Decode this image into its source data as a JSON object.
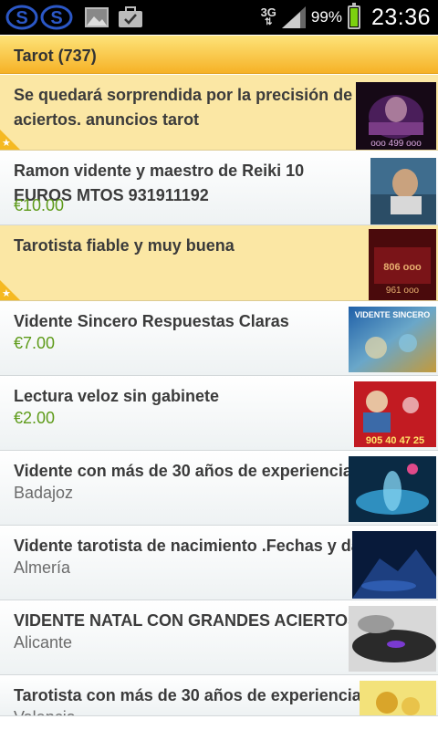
{
  "status_bar": {
    "network": "3G",
    "battery": "99%",
    "battery_level": 0.99,
    "time": "23:36",
    "icons": [
      "app-s-icon",
      "app-s-icon",
      "gallery-icon",
      "briefcase-check-icon",
      "signal-icon",
      "battery-icon"
    ]
  },
  "category": {
    "title": "Tarot (737)"
  },
  "listings": [
    {
      "title": "Se quedará sorprendida por la precisión de aciertos. anuncios tarot",
      "featured": true
    },
    {
      "title": "Ramon vidente y maestro de Reiki 10 EUROS MTOS 931911192",
      "price": "€10.00"
    },
    {
      "title": "Tarotista fiable y muy buena",
      "featured": true
    },
    {
      "title": "Vidente Sincero Respuestas Claras",
      "price": "€7.00",
      "thumb_text": "VIDENTE SINCERO"
    },
    {
      "title": "Lectura veloz sin gabinete",
      "price": "€2.00",
      "thumb_text": "905 40 47 25"
    },
    {
      "title": "Vidente con más de 30 años de experiencia",
      "location": "Badajoz"
    },
    {
      "title": "Vidente tarotista de nacimiento .Fechas y datos",
      "location": "Almería"
    },
    {
      "title": "VIDENTE NATAL CON GRANDES ACIERTOS",
      "location": "Alicante"
    },
    {
      "title": "Tarotista con más de 30 años de experiencia",
      "location": "Valencia"
    }
  ],
  "colors": {
    "header_top": "#fde37a",
    "header_bottom": "#f6b226",
    "featured_bg": "#fbe7a4",
    "price": "#5e9b1a"
  }
}
